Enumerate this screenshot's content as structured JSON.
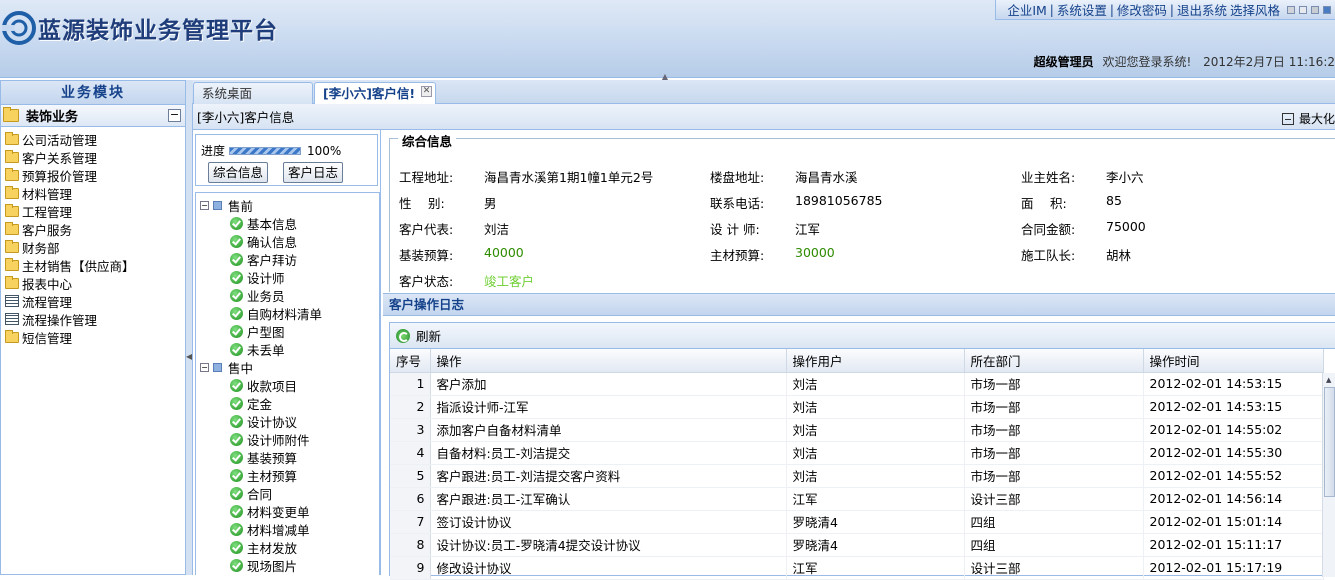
{
  "app": {
    "title": "蓝源装饰业务管理平台",
    "top_links": [
      "企业IM",
      "系统设置",
      "修改密码",
      "退出系统",
      "选择风格"
    ],
    "user_role": "超级管理员",
    "welcome": "欢迎您登录系统!",
    "datetime": "2012年2月7日 11:16:2"
  },
  "sidebar": {
    "title": "业务模块",
    "group": "装饰业务",
    "collapse_glyph": "−",
    "items": [
      {
        "label": "公司活动管理",
        "icon": "folder-icon"
      },
      {
        "label": "客户关系管理",
        "icon": "folder-icon"
      },
      {
        "label": "预算报价管理",
        "icon": "folder-icon"
      },
      {
        "label": "材料管理",
        "icon": "folder-icon"
      },
      {
        "label": "工程管理",
        "icon": "folder-icon"
      },
      {
        "label": "客户服务",
        "icon": "folder-icon"
      },
      {
        "label": "财务部",
        "icon": "folder-icon"
      },
      {
        "label": "主材销售【供应商】",
        "icon": "folder-icon"
      },
      {
        "label": "报表中心",
        "icon": "folder-icon"
      },
      {
        "label": "流程管理",
        "icon": "list-icon"
      },
      {
        "label": "流程操作管理",
        "icon": "list-icon"
      },
      {
        "label": "短信管理",
        "icon": "folder-icon"
      }
    ]
  },
  "tabs": [
    {
      "label": "系统桌面"
    },
    {
      "label": "[李小六]客户信!"
    }
  ],
  "panel": {
    "title": "[李小六]客户信息",
    "maximize_label": "最大化"
  },
  "progress": {
    "label": "进度",
    "value_text": "100%",
    "value": 1.0,
    "buttons": [
      "综合信息",
      "客户日志"
    ]
  },
  "tree": [
    {
      "label": "售前",
      "children": [
        "基本信息",
        "确认信息",
        "客户拜访",
        "设计师",
        "业务员",
        "自购材料清单",
        "户型图",
        "未丢单"
      ]
    },
    {
      "label": "售中",
      "children": [
        "收款项目",
        "定金",
        "设计协议",
        "设计师附件",
        "基装预算",
        "主材预算",
        "合同",
        "材料变更单",
        "材料增减单",
        "主材发放",
        "现场图片"
      ]
    }
  ],
  "info": {
    "legend": "综合信息",
    "fields": {
      "address_label": "工程地址:",
      "address": "海昌青水溪第1期1幢1单元2号",
      "estate_label": "楼盘地址:",
      "estate": "海昌青水溪",
      "owner_label": "业主姓名:",
      "owner": "李小六",
      "gender_label": "性　 别:",
      "gender": "男",
      "phone_label": "联系电话:",
      "phone": "18981056785",
      "area_label": "面　 积:",
      "area": "85",
      "rep_label": "客户代表:",
      "rep": "刘洁",
      "designer_label": "设 计 师:",
      "designer": "江军",
      "contract_label": "合同金额:",
      "contract": "75000",
      "base_budget_label": "基装预算:",
      "base_budget": "40000",
      "main_budget_label": "主材预算:",
      "main_budget": "30000",
      "foreman_label": "施工队长:",
      "foreman": "胡林",
      "status_label": "客户状态:",
      "status": "竣工客户"
    }
  },
  "log": {
    "title": "客户操作日志",
    "refresh_label": "刷新",
    "columns": [
      "序号",
      "操作",
      "操作用户",
      "所在部门",
      "操作时间"
    ],
    "rows": [
      [
        "1",
        "客户添加",
        "刘洁",
        "市场一部",
        "2012-02-01 14:53:15"
      ],
      [
        "2",
        "指派设计师-江军",
        "刘洁",
        "市场一部",
        "2012-02-01 14:53:15"
      ],
      [
        "3",
        "添加客户自备材料清单",
        "刘洁",
        "市场一部",
        "2012-02-01 14:55:02"
      ],
      [
        "4",
        "自备材料:员工-刘洁提交",
        "刘洁",
        "市场一部",
        "2012-02-01 14:55:30"
      ],
      [
        "5",
        "客户跟进:员工-刘洁提交客户资料",
        "刘洁",
        "市场一部",
        "2012-02-01 14:55:52"
      ],
      [
        "6",
        "客户跟进:员工-江军确认",
        "江军",
        "设计三部",
        "2012-02-01 14:56:14"
      ],
      [
        "7",
        "签订设计协议",
        "罗晓清4",
        "四组",
        "2012-02-01 15:01:14"
      ],
      [
        "8",
        "设计协议:员工-罗晓清4提交设计协议",
        "罗晓清4",
        "四组",
        "2012-02-01 15:11:17"
      ],
      [
        "9",
        "修改设计协议",
        "江军",
        "设计三部",
        "2012-02-01 15:17:19"
      ]
    ]
  },
  "colors": {
    "accent": "#15428b",
    "border": "#99bbe8",
    "positive": "#2e8b00",
    "status": "#6fcf33"
  }
}
